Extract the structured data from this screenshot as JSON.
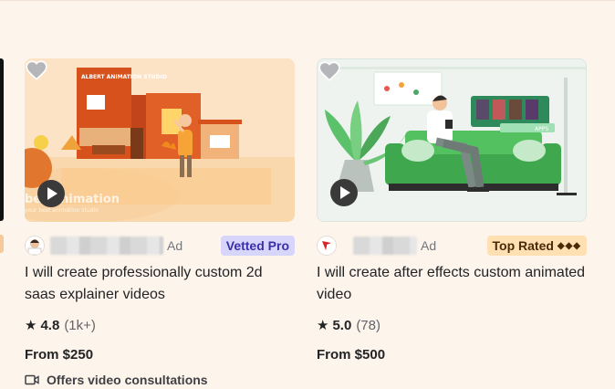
{
  "cards": [
    {
      "thumbnail": {
        "sign_text": "ALBERT ANIMATION STUDIO",
        "watermark": "ber Animation",
        "watermark_sub": "your best animation studio"
      },
      "ad_label": "Ad",
      "badge": {
        "label": "Vetted Pro",
        "color": "#d8d5fb",
        "text_color": "#3a2fa8"
      },
      "title": "I will create professionally custom 2d saas explainer videos",
      "rating": {
        "score": "4.8",
        "count": "(1k+)"
      },
      "price": "From $250",
      "extra": "Offers video consultations"
    },
    {
      "thumbnail": {
        "screen_label": "APPS"
      },
      "ad_label": "Ad",
      "badge": {
        "label": "Top Rated",
        "diamonds": "◆◆◆",
        "color": "#ffe0b3",
        "text_color": "#4a2a06"
      },
      "title": "I will create after effects custom animated video",
      "rating": {
        "score": "5.0",
        "count": "(78)"
      },
      "price": "From $500"
    }
  ],
  "icons": {
    "favorite": "heart-icon",
    "play": "play-icon",
    "rating": "star-icon",
    "consultation": "video-camera-icon"
  },
  "colors": {
    "page_background": "#fdf4ec",
    "text": "#222325",
    "muted": "#74767e"
  }
}
